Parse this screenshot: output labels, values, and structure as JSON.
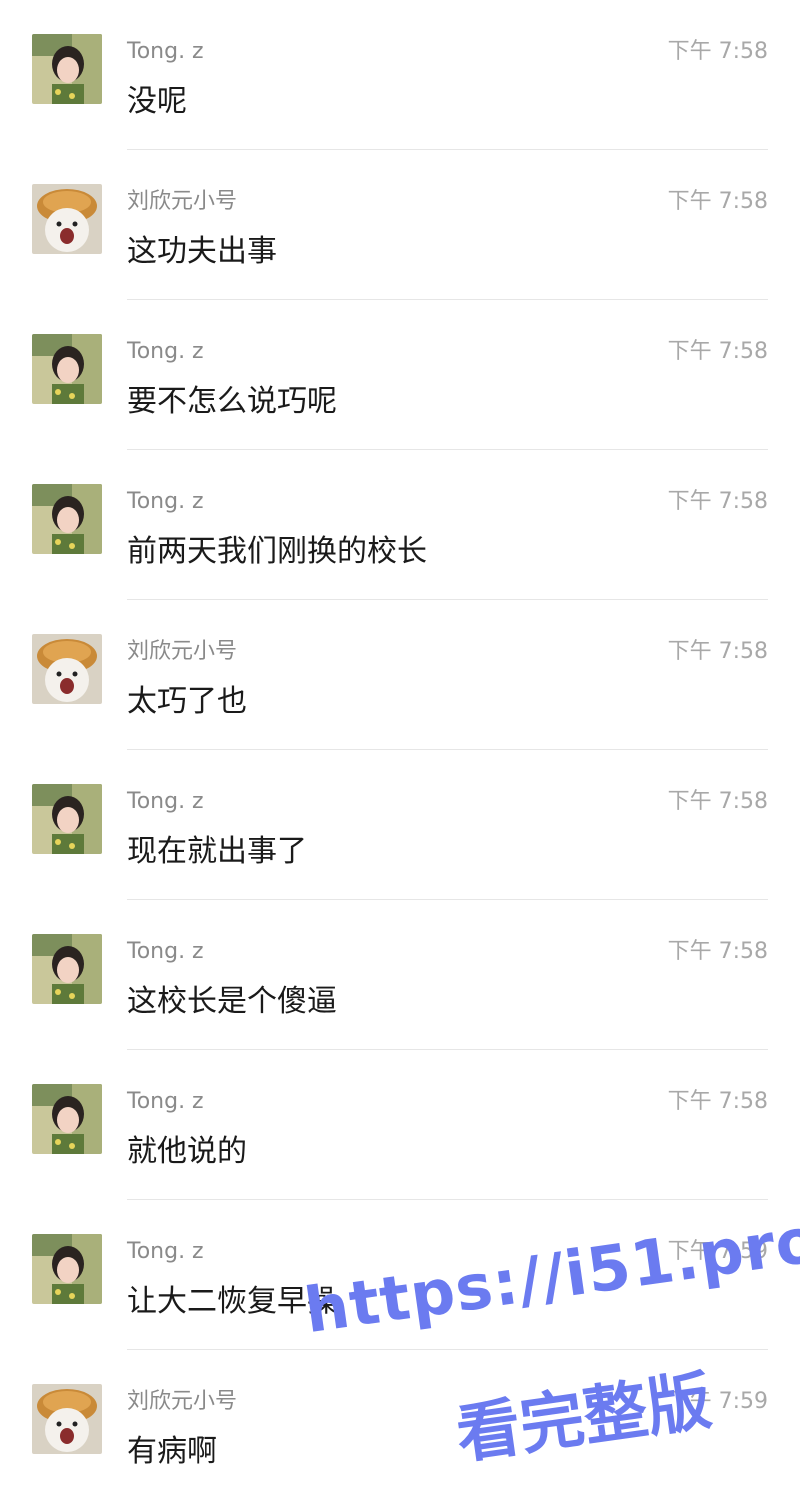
{
  "senders": {
    "tong": "Tong. z",
    "liu": "刘欣元小号"
  },
  "messages": [
    {
      "sender": "Tong. z",
      "avatar": "girl-avatar",
      "time": "下午 7:58",
      "text": "没呢"
    },
    {
      "sender": "刘欣元小号",
      "avatar": "dog-bread-avatar",
      "time": "下午 7:58",
      "text": "这功夫出事"
    },
    {
      "sender": "Tong. z",
      "avatar": "girl-avatar",
      "time": "下午 7:58",
      "text": "要不怎么说巧呢"
    },
    {
      "sender": "Tong. z",
      "avatar": "girl-avatar",
      "time": "下午 7:58",
      "text": "前两天我们刚换的校长"
    },
    {
      "sender": "刘欣元小号",
      "avatar": "dog-bread-avatar",
      "time": "下午 7:58",
      "text": "太巧了也"
    },
    {
      "sender": "Tong. z",
      "avatar": "girl-avatar",
      "time": "下午 7:58",
      "text": "现在就出事了"
    },
    {
      "sender": "Tong. z",
      "avatar": "girl-avatar",
      "time": "下午 7:58",
      "text": "这校长是个傻逼"
    },
    {
      "sender": "Tong. z",
      "avatar": "girl-avatar",
      "time": "下午 7:58",
      "text": "就他说的"
    },
    {
      "sender": "Tong. z",
      "avatar": "girl-avatar",
      "time": "下午 7:59",
      "text": "让大二恢复早操"
    },
    {
      "sender": "刘欣元小号",
      "avatar": "dog-bread-avatar",
      "time": "下午 7:59",
      "text": "有病啊"
    }
  ],
  "watermark": {
    "line1": "https://i51.pro",
    "line2": "看完整版"
  },
  "colors": {
    "sender": "#8a8a8a",
    "time": "#a8a8a8",
    "text": "#1a1a1a",
    "divider": "#e6e6e6",
    "watermark": "#6b7bf0"
  }
}
